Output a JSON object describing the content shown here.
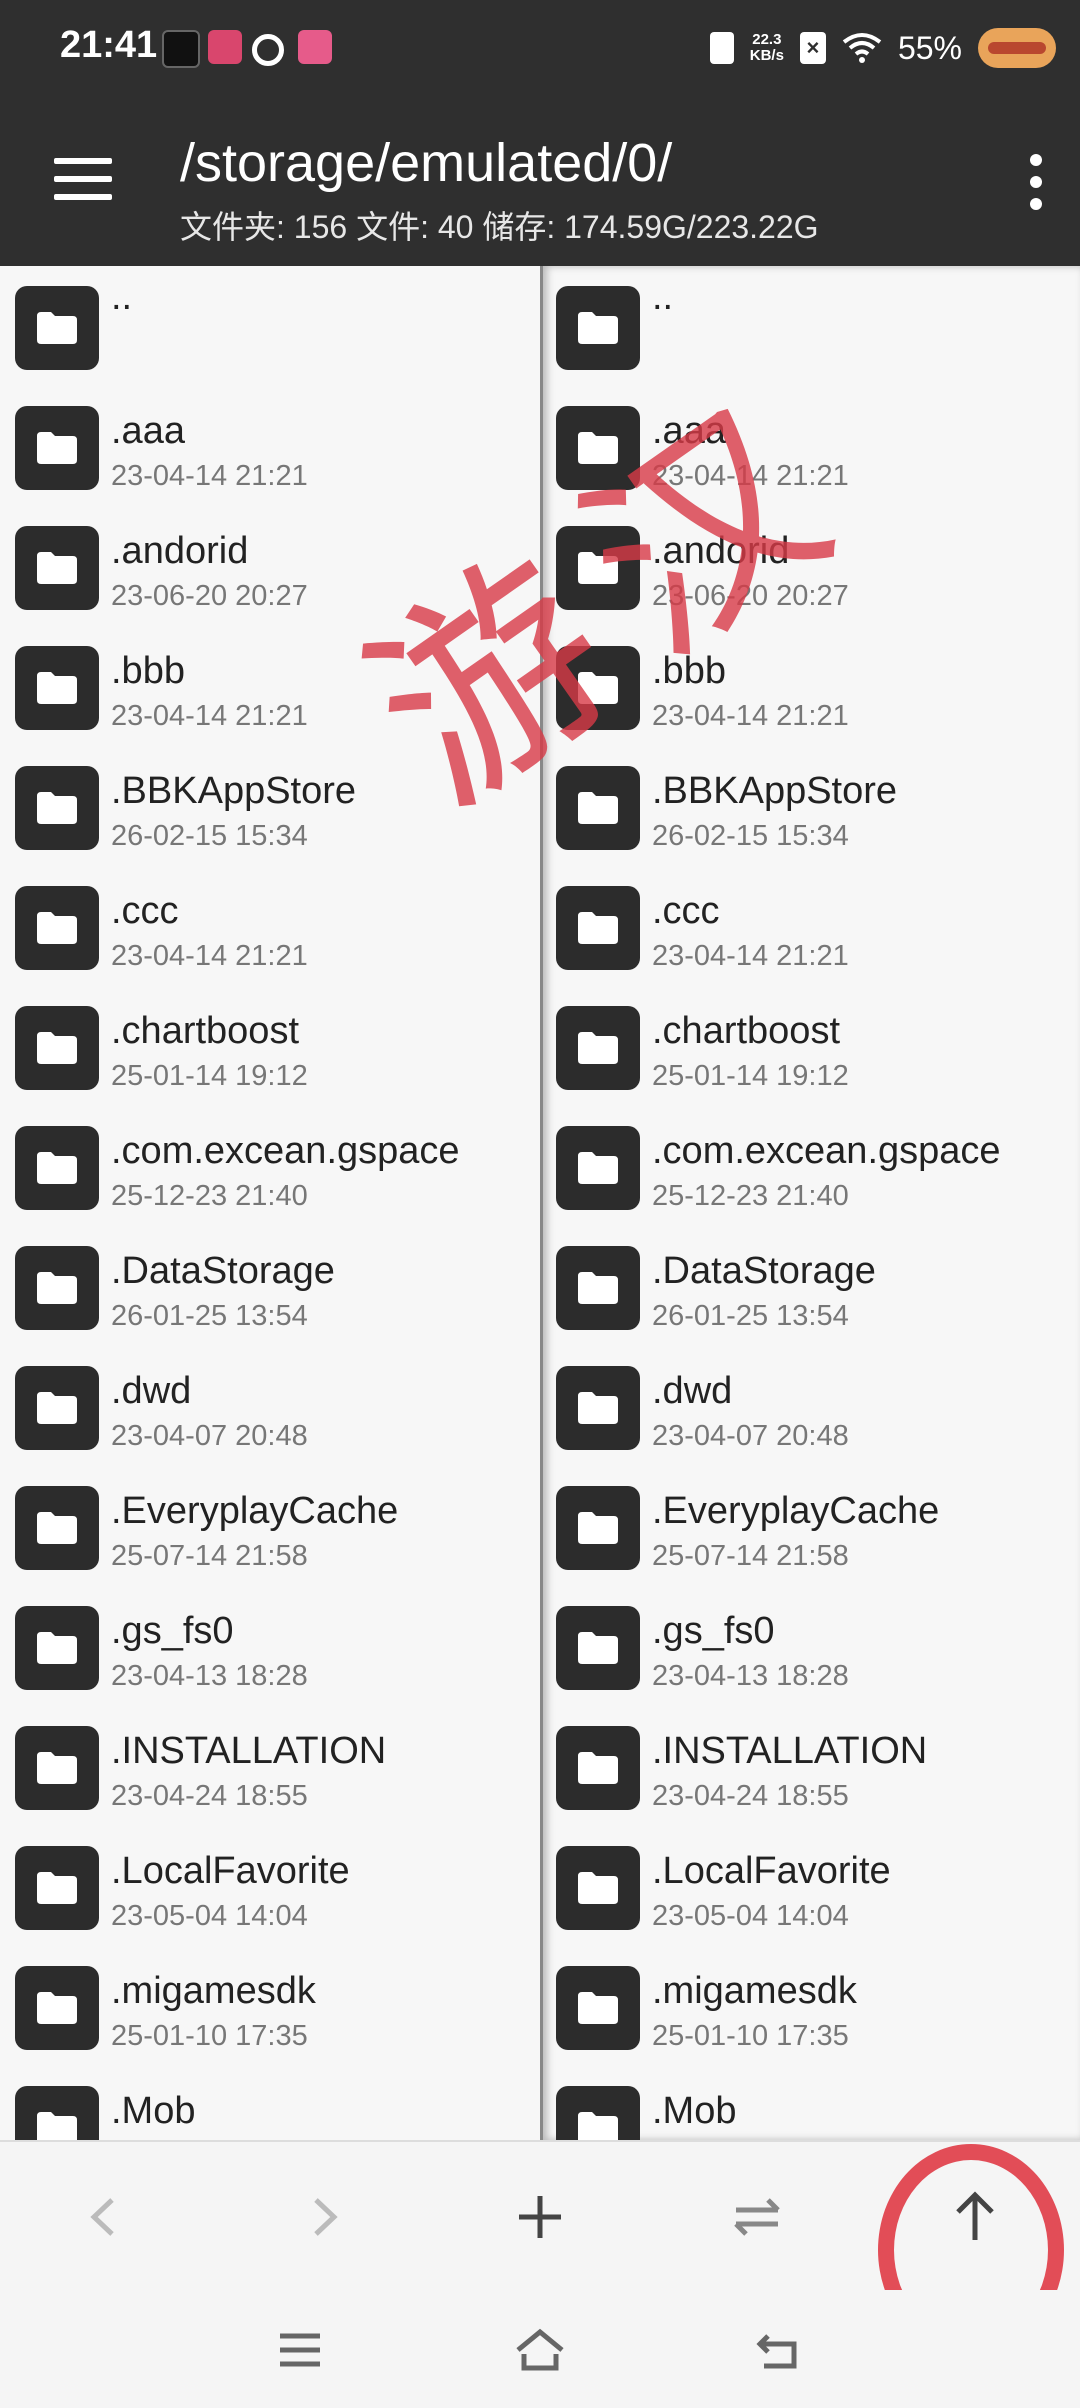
{
  "status_bar": {
    "time": "21:41",
    "net_speed": "22.3\nKB/s",
    "battery": "55%"
  },
  "toolbar": {
    "path": "/storage/emulated/0/",
    "summary": "文件夹: 156  文件: 40  储存: 174.59G/223.22G"
  },
  "files": [
    {
      "name": "..",
      "date": ""
    },
    {
      "name": ".aaa",
      "date": "23-04-14 21:21"
    },
    {
      "name": ".andorid",
      "date": "23-06-20 20:27"
    },
    {
      "name": ".bbb",
      "date": "23-04-14 21:21"
    },
    {
      "name": ".BBKAppStore",
      "date": "26-02-15 15:34"
    },
    {
      "name": ".ccc",
      "date": "23-04-14 21:21"
    },
    {
      "name": ".chartboost",
      "date": "25-01-14 19:12"
    },
    {
      "name": ".com.excean.gspace",
      "date": "25-12-23 21:40"
    },
    {
      "name": ".DataStorage",
      "date": "26-01-25 13:54"
    },
    {
      "name": ".dwd",
      "date": "23-04-07 20:48"
    },
    {
      "name": ".EveryplayCache",
      "date": "25-07-14 21:58"
    },
    {
      "name": ".gs_fs0",
      "date": "23-04-13 18:28"
    },
    {
      "name": ".INSTALLATION",
      "date": "23-04-24 18:55"
    },
    {
      "name": ".LocalFavorite",
      "date": "23-05-04 14:04"
    },
    {
      "name": ".migamesdk",
      "date": "25-01-10 17:35"
    },
    {
      "name": ".Mob",
      "date": ""
    }
  ],
  "watermark": "游汉",
  "colors": {
    "bar": "#2f2f2f",
    "accent_mark": "#e03b46",
    "folder_icon_bg": "#2c2c2c"
  }
}
